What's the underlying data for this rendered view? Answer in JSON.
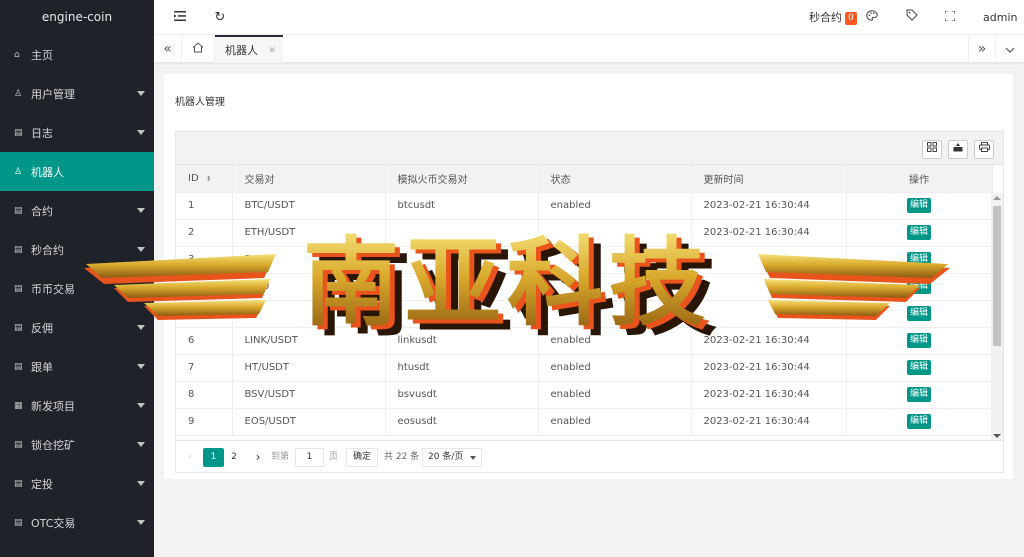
{
  "app": {
    "title": "engine-coin"
  },
  "sidebar": {
    "items": [
      {
        "label": "主页",
        "icon": "home-icon",
        "caret": false,
        "active": false
      },
      {
        "label": "用户管理",
        "icon": "user-icon",
        "caret": true,
        "active": false
      },
      {
        "label": "日志",
        "icon": "document-icon",
        "caret": true,
        "active": false
      },
      {
        "label": "机器人",
        "icon": "user-icon",
        "caret": false,
        "active": true
      },
      {
        "label": "合约",
        "icon": "document-icon",
        "caret": true,
        "active": false
      },
      {
        "label": "秒合约",
        "icon": "document-icon",
        "caret": true,
        "active": false
      },
      {
        "label": "币币交易",
        "icon": "document-icon",
        "caret": false,
        "active": false
      },
      {
        "label": "反佣",
        "icon": "document-icon",
        "caret": true,
        "active": false
      },
      {
        "label": "跟单",
        "icon": "document-icon",
        "caret": true,
        "active": false
      },
      {
        "label": "新发项目",
        "icon": "grid-icon",
        "caret": true,
        "active": false
      },
      {
        "label": "锁仓挖矿",
        "icon": "document-icon",
        "caret": true,
        "active": false
      },
      {
        "label": "定投",
        "icon": "document-icon",
        "caret": true,
        "active": false
      },
      {
        "label": "OTC交易",
        "icon": "document-icon",
        "caret": true,
        "active": false
      }
    ]
  },
  "topbar": {
    "second_contract_label": "秒合约",
    "second_contract_count": "0",
    "user": "admin"
  },
  "tabs": {
    "active_label": "机器人"
  },
  "main": {
    "title": "机器人管理",
    "columns": [
      "ID",
      "交易对",
      "模拟火币交易对",
      "状态",
      "更新时间",
      "操作"
    ],
    "rows": [
      {
        "id": "1",
        "pair": "BTC/USDT",
        "sim": "btcusdt",
        "status": "enabled",
        "updated": "2023-02-21 16:30:44",
        "action": "编辑"
      },
      {
        "id": "2",
        "pair": "ETH/USDT",
        "sim": "",
        "status": "",
        "updated": "2023-02-21 16:30:44",
        "action": "编辑"
      },
      {
        "id": "3",
        "pair": "DOG",
        "sim": "",
        "status": "",
        "updated": "",
        "action": "编辑"
      },
      {
        "id": "4",
        "pair": "FIL/U",
        "sim": "",
        "status": "",
        "updated": "",
        "action": "编辑"
      },
      {
        "id": "5",
        "pair": "",
        "sim": "",
        "status": "",
        "updated": "",
        "action": "编辑"
      },
      {
        "id": "6",
        "pair": "LINK/USDT",
        "sim": "linkusdt",
        "status": "enabled",
        "updated": "2023-02-21 16:30:44",
        "action": "编辑"
      },
      {
        "id": "7",
        "pair": "HT/USDT",
        "sim": "htusdt",
        "status": "enabled",
        "updated": "2023-02-21 16:30:44",
        "action": "编辑"
      },
      {
        "id": "8",
        "pair": "BSV/USDT",
        "sim": "bsvusdt",
        "status": "enabled",
        "updated": "2023-02-21 16:30:44",
        "action": "编辑"
      },
      {
        "id": "9",
        "pair": "EOS/USDT",
        "sim": "eosusdt",
        "status": "enabled",
        "updated": "2023-02-21 16:30:44",
        "action": "编辑"
      }
    ],
    "pagination": {
      "current": "1",
      "next_page": "2",
      "goto_label": "到第",
      "goto_value": "1",
      "page_unit": "页",
      "confirm": "确定",
      "total": "共 22 条",
      "page_size": "20 条/页"
    }
  },
  "watermark": {
    "text": "南亚科技"
  },
  "colors": {
    "accent": "#009688",
    "sidebar_bg": "#20222a",
    "badge": "#ff5722"
  }
}
